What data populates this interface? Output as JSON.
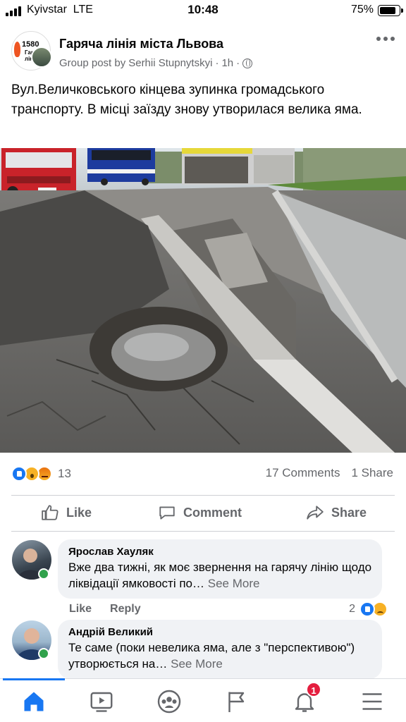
{
  "status_bar": {
    "carrier": "Kyivstar",
    "network": "LTE",
    "time": "10:48",
    "battery": "75%",
    "battery_level": 0.75
  },
  "post": {
    "group_name": "Гаряча лінія міста Львова",
    "group_avatar_text": [
      "1580",
      "Гаряча",
      "лінія"
    ],
    "meta_prefix": "Group post by",
    "author": "Serhii Stupnytskyi",
    "time_ago": "1h",
    "separator": "·",
    "text": "Вул.Величковського кінцева зупинка громадського транспорту. В місці заїзду знову утворилася велика яма.",
    "reaction_count": "13",
    "comments_count": "17 Comments",
    "shares_count": "1 Share"
  },
  "actions": {
    "like": "Like",
    "comment": "Comment",
    "share": "Share"
  },
  "comments": [
    {
      "name": "Ярослав Хауляк",
      "text": "Вже два тижні, як моє звернення на гарячу лінію щодо ліквідації ямковості по…",
      "see_more": "See More",
      "like_label": "Like",
      "reply_label": "Reply",
      "reaction_count": "2"
    },
    {
      "name": "Андрій Великий",
      "text": "Те саме (поки невелика яма, але з \"перспективою\") утворюється на…",
      "see_more": "See More"
    }
  ],
  "nav": {
    "notifications_badge": "1"
  },
  "colors": {
    "accent": "#1877f2",
    "secondary_text": "#65676b",
    "bubble_bg": "#f0f2f5",
    "badge": "#e41e3f",
    "online": "#31a24c"
  }
}
